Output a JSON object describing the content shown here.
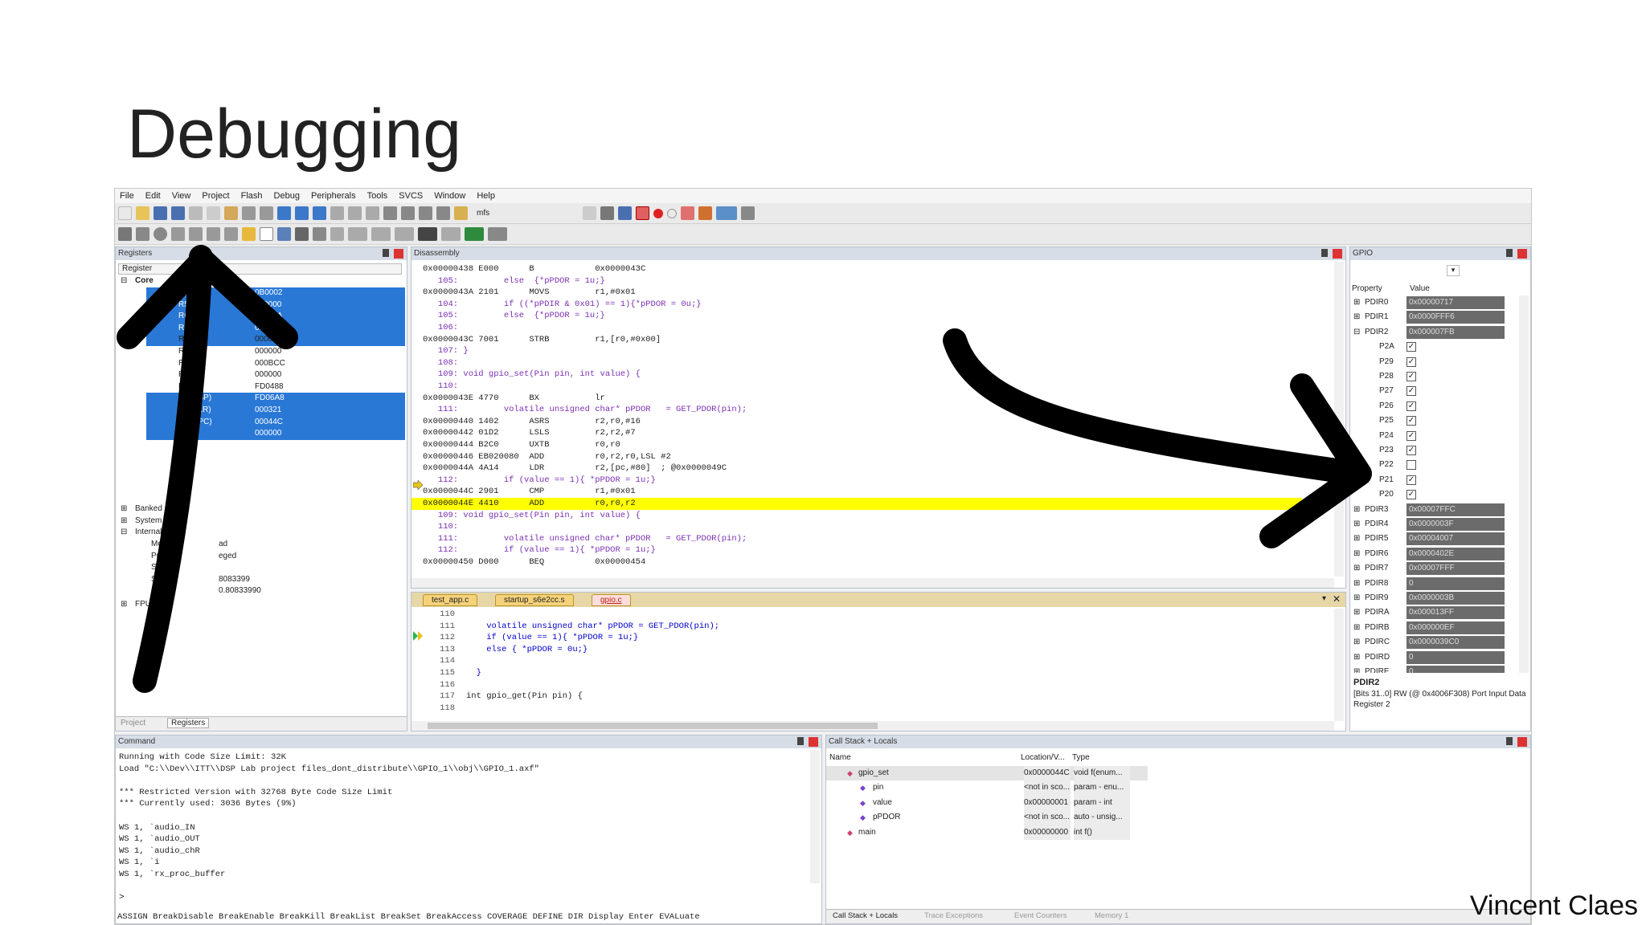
{
  "slide": {
    "title": "Debugging",
    "author": "Vincent Claes"
  },
  "menu": [
    "File",
    "Edit",
    "View",
    "Project",
    "Flash",
    "Debug",
    "Peripherals",
    "Tools",
    "SVCS",
    "Window",
    "Help"
  ],
  "toolbar": {
    "target_field": "mfs"
  },
  "registers": {
    "title": "Registers",
    "header": "Register",
    "group_core": "Core",
    "rows": [
      {
        "name": "R4",
        "value": "0B0002",
        "sel": true
      },
      {
        "name": "R5",
        "value": "020000",
        "sel": true
      },
      {
        "name": "R6",
        "value": "01000A",
        "sel": true
      },
      {
        "name": "R7",
        "value": "010008",
        "sel": true
      },
      {
        "name": "R8",
        "value": "000000",
        "sel": false
      },
      {
        "name": "R9",
        "value": "000000",
        "sel": false
      },
      {
        "name": "R10",
        "value": "000BCC",
        "sel": false
      },
      {
        "name": "R11",
        "value": "000000",
        "sel": false
      },
      {
        "name": "R12",
        "value": "FD0488",
        "sel": false
      },
      {
        "name": "R13 (SP)",
        "value": "FD06A8",
        "sel": true
      },
      {
        "name": "R14 (LR)",
        "value": "000321",
        "sel": true
      },
      {
        "name": "R15 (PC)",
        "value": "00044C",
        "sel": true
      },
      {
        "name": "xPSR",
        "value": "000000",
        "sel": true
      }
    ],
    "groups": [
      "Banked",
      "System",
      "Internal"
    ],
    "internal": [
      {
        "name": "Mode",
        "value": "ad"
      },
      {
        "name": "Privilege",
        "value": "eged"
      },
      {
        "name": "Stack",
        "value": ""
      },
      {
        "name": "States",
        "value": "8083399"
      },
      {
        "name": "Sec",
        "value": "0.80833990"
      }
    ],
    "fpu": "FPU",
    "tab_project": "Project",
    "tab_registers": "Registers"
  },
  "disassembly": {
    "title": "Disassembly",
    "lines": [
      {
        "t": "0x00000438 E000      B            0x0000043C",
        "k": "asm"
      },
      {
        "t": "   105:         else  {*pPDOR = 1u;}",
        "k": "src"
      },
      {
        "t": "0x0000043A 2101      MOVS         r1,#0x01",
        "k": "asm"
      },
      {
        "t": "   104:         if ((*pPDIR & 0x01) == 1){*pPDOR = 0u;}",
        "k": "src"
      },
      {
        "t": "   105:         else  {*pPDOR = 1u;}",
        "k": "src"
      },
      {
        "t": "   106:",
        "k": "src"
      },
      {
        "t": "0x0000043C 7001      STRB         r1,[r0,#0x00]",
        "k": "asm"
      },
      {
        "t": "   107: }",
        "k": "src"
      },
      {
        "t": "   108:",
        "k": "src"
      },
      {
        "t": "   109: void gpio_set(Pin pin, int value) {",
        "k": "src"
      },
      {
        "t": "   110:",
        "k": "src"
      },
      {
        "t": "0x0000043E 4770      BX           lr",
        "k": "asm"
      },
      {
        "t": "   111:         volatile unsigned char* pPDOR   = GET_PDOR(pin);",
        "k": "src"
      },
      {
        "t": "0x00000440 1402      ASRS         r2,r0,#16",
        "k": "asm"
      },
      {
        "t": "0x00000442 01D2      LSLS         r2,r2,#7",
        "k": "asm"
      },
      {
        "t": "0x00000444 B2C0      UXTB         r0,r0",
        "k": "asm"
      },
      {
        "t": "0x00000446 EB020080  ADD          r0,r2,r0,LSL #2",
        "k": "asm"
      },
      {
        "t": "0x0000044A 4A14      LDR          r2,[pc,#80]  ; @0x0000049C",
        "k": "asm"
      },
      {
        "t": "   112:         if (value == 1){ *pPDOR = 1u;}",
        "k": "src"
      },
      {
        "t": "0x0000044C 2901      CMP          r1,#0x01",
        "k": "asm"
      },
      {
        "t": "0x0000044E 4410      ADD          r0,r0,r2",
        "k": "hl"
      },
      {
        "t": "   109: void gpio_set(Pin pin, int value) {",
        "k": "src"
      },
      {
        "t": "   110:",
        "k": "src"
      },
      {
        "t": "   111:         volatile unsigned char* pPDOR   = GET_PDOR(pin);",
        "k": "src"
      },
      {
        "t": "   112:         if (value == 1){ *pPDOR = 1u;}",
        "k": "src"
      },
      {
        "t": "0x00000450 D000      BEQ          0x00000454",
        "k": "asm"
      }
    ]
  },
  "editor": {
    "tabs": [
      "test_app.c",
      "startup_s6e2cc.s",
      "gpio.c"
    ],
    "lines": [
      {
        "n": "110",
        "t": ""
      },
      {
        "n": "111",
        "t": "    volatile unsigned char* pPDOR = GET_PDOR(pin);"
      },
      {
        "n": "112",
        "t": "    if (value == 1){ *pPDOR = 1u;}"
      },
      {
        "n": "113",
        "t": "    else { *pPDOR = 0u;}"
      },
      {
        "n": "114",
        "t": ""
      },
      {
        "n": "115",
        "t": "  }"
      },
      {
        "n": "116",
        "t": ""
      },
      {
        "n": "117",
        "t": "int gpio_get(Pin pin) {"
      },
      {
        "n": "118",
        "t": ""
      }
    ]
  },
  "gpio": {
    "title": "GPIO",
    "col_property": "Property",
    "col_value": "Value",
    "top": [
      {
        "name": "PDIR0",
        "value": "0x00000717"
      },
      {
        "name": "PDIR1",
        "value": "0x0000FFF6"
      },
      {
        "name": "PDIR2",
        "value": "0x000007FB"
      }
    ],
    "bits": [
      {
        "name": "P2A",
        "checked": true
      },
      {
        "name": "P29",
        "checked": true
      },
      {
        "name": "P28",
        "checked": true
      },
      {
        "name": "P27",
        "checked": true
      },
      {
        "name": "P26",
        "checked": true
      },
      {
        "name": "P25",
        "checked": true
      },
      {
        "name": "P24",
        "checked": true
      },
      {
        "name": "P23",
        "checked": true
      },
      {
        "name": "P22",
        "checked": false
      },
      {
        "name": "P21",
        "checked": true
      },
      {
        "name": "P20",
        "checked": true
      }
    ],
    "bottom": [
      {
        "name": "PDIR3",
        "value": "0x00007FFC"
      },
      {
        "name": "PDIR4",
        "value": "0x0000003F"
      },
      {
        "name": "PDIR5",
        "value": "0x00004007"
      },
      {
        "name": "PDIR6",
        "value": "0x0000402E"
      },
      {
        "name": "PDIR7",
        "value": "0x00007FFF"
      },
      {
        "name": "PDIR8",
        "value": "0"
      },
      {
        "name": "PDIR9",
        "value": "0x0000003B"
      },
      {
        "name": "PDIRA",
        "value": "0x000013FF"
      },
      {
        "name": "PDIRB",
        "value": "0x000000EF"
      },
      {
        "name": "PDIRC",
        "value": "0x0000039C0"
      },
      {
        "name": "PDIRD",
        "value": "0"
      },
      {
        "name": "PDIRE",
        "value": "0"
      }
    ],
    "desc_title": "PDIR2",
    "desc_text": "[Bits 31..0] RW (@ 0x4006F308) Port Input Data Register 2"
  },
  "command": {
    "title": "Command",
    "lines": [
      "Running with Code Size Limit: 32K",
      "Load \"C:\\\\Dev\\\\ITT\\\\DSP Lab project files_dont_distribute\\\\GPIO_1\\\\obj\\\\GPIO_1.axf\"",
      "",
      "*** Restricted Version with 32768 Byte Code Size Limit",
      "*** Currently used: 3036 Bytes (9%)",
      "",
      "WS 1, `audio_IN",
      "WS 1, `audio_OUT",
      "WS 1, `audio_chR",
      "WS 1, `i",
      "WS 1, `rx_proc_buffer"
    ],
    "prompt": ">",
    "hint": "ASSIGN BreakDisable BreakEnable BreakKill BreakList BreakSet BreakAccess COVERAGE DEFINE DIR Display Enter EVALuate"
  },
  "callstack": {
    "title": "Call Stack + Locals",
    "cols": [
      "Name",
      "Location/V...",
      "Type"
    ],
    "rows": [
      {
        "name": "gpio_set",
        "loc": "0x0000044C",
        "type": "void f(enum...",
        "indent": 0
      },
      {
        "name": "pin",
        "loc": "<not in sco...",
        "type": "param - enu...",
        "indent": 1
      },
      {
        "name": "value",
        "loc": "0x00000001",
        "type": "param - int",
        "indent": 1
      },
      {
        "name": "pPDOR",
        "loc": "<not in sco...",
        "type": "auto - unsig...",
        "indent": 1
      },
      {
        "name": "main",
        "loc": "0x00000000",
        "type": "int f()",
        "indent": 0
      }
    ],
    "tabs": [
      "Call Stack + Locals",
      "Trace Exceptions",
      "Event Counters",
      "Memory 1"
    ]
  },
  "colors": {
    "selection": "#2a78d6",
    "highlight": "#ffff00",
    "gpio_value_bg": "#6b6b6b",
    "arrow": "#000000"
  }
}
